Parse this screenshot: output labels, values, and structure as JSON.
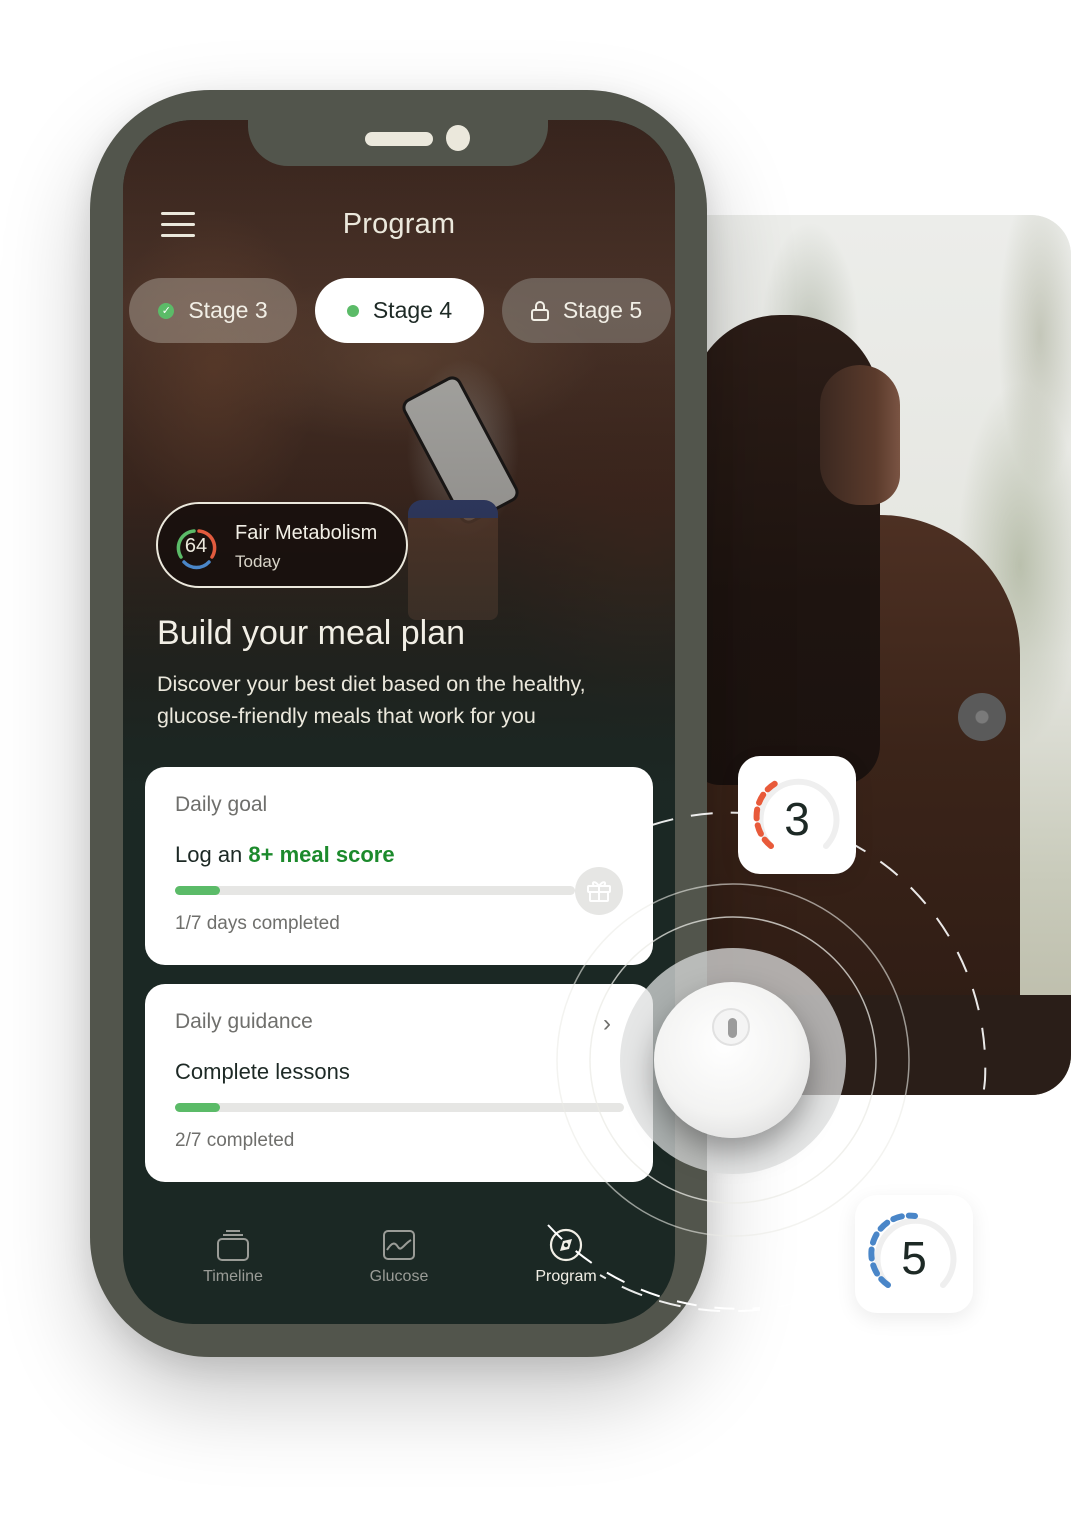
{
  "app": {
    "screen_title": "Program"
  },
  "stages": [
    {
      "label": "Stage 3",
      "state": "completed",
      "icon": "check-circle-icon"
    },
    {
      "label": "Stage 4",
      "state": "active",
      "icon": "dot-icon"
    },
    {
      "label": "Stage 5",
      "state": "locked",
      "icon": "lock-icon"
    }
  ],
  "metabolism": {
    "score": "64",
    "title": "Fair Metabolism",
    "subtitle": "Today",
    "gauge_colors": {
      "good": "#5bbb68",
      "warn": "#e25b3e",
      "low": "#4a86c8"
    }
  },
  "hero": {
    "heading": "Build your meal plan",
    "body": "Discover your best diet based on the healthy, glucose-friendly meals that work for you"
  },
  "daily_goal": {
    "label": "Daily goal",
    "title_prefix": "Log an ",
    "title_accent": "8+ meal score",
    "progress": {
      "completed": 1,
      "total": 7
    },
    "status": "1/7 days completed",
    "reward_icon": "gift-icon"
  },
  "daily_guidance": {
    "label": "Daily guidance",
    "title": "Complete lessons",
    "progress": {
      "completed": 2,
      "total": 7
    },
    "status": "2/7 completed"
  },
  "tabbar": [
    {
      "label": "Timeline",
      "icon": "timeline-icon",
      "active": false
    },
    {
      "label": "Glucose",
      "icon": "glucose-chart-icon",
      "active": false
    },
    {
      "label": "Program",
      "icon": "program-compass-icon",
      "active": true
    }
  ],
  "badges": [
    {
      "number": "3",
      "color": "#e85a3a"
    },
    {
      "number": "5",
      "color": "#4a86c8"
    }
  ],
  "colors": {
    "accent_green": "#5bbb68",
    "text_green": "#1c8a2c",
    "phone_frame": "#52554c",
    "screen_dark": "#1b2824"
  }
}
